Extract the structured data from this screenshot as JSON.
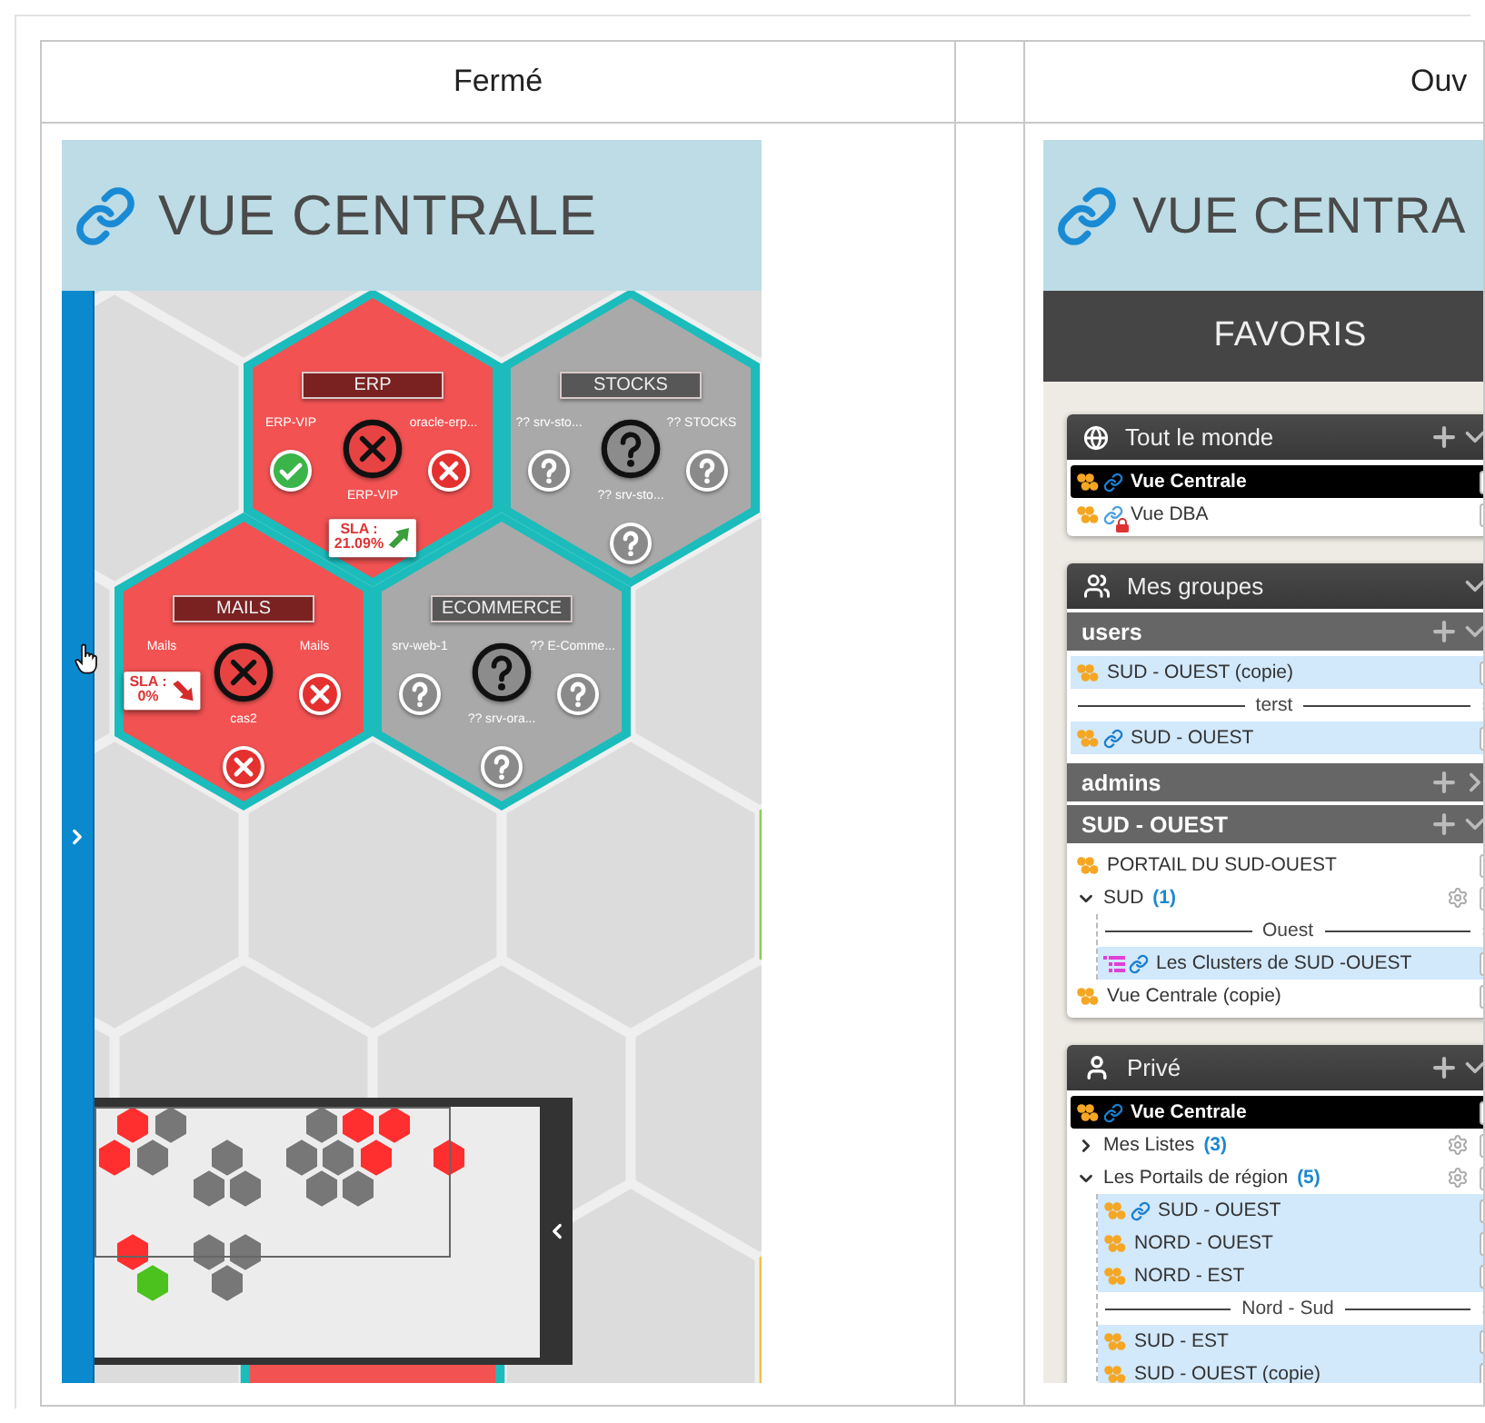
{
  "column_1": {
    "header": "Fermé",
    "screenshot": {
      "title": "VUE CENTRALE",
      "tiles": [
        {
          "title": "ERP",
          "critical": true,
          "nodes": [
            {
              "kind": "ok",
              "label": "ERP-VIP"
            },
            {
              "kind": "critical",
              "label": "oracle-erp..."
            },
            {
              "kind": "sla",
              "label": "ERP-VIP",
              "sla": {
                "label": "SLA :",
                "value": "21.09%",
                "rising": true
              }
            }
          ]
        },
        {
          "title": "STOCKS",
          "critical": false,
          "nodes": [
            {
              "kind": "unknown",
              "label": "?? srv-sto..."
            },
            {
              "kind": "unknown",
              "label": "?? STOCKS"
            },
            {
              "kind": "unknown",
              "label": "?? srv-sto..."
            }
          ]
        },
        {
          "title": "MAILS",
          "critical": true,
          "nodes": [
            {
              "kind": "sla",
              "label": "Mails",
              "sla": {
                "label": "SLA :",
                "value": "0%",
                "rising": false
              }
            },
            {
              "kind": "critical",
              "label": "Mails"
            },
            {
              "kind": "critical",
              "label": "cas2"
            }
          ]
        },
        {
          "title": "ECOMMERCE",
          "critical": false,
          "nodes": [
            {
              "kind": "unknown",
              "label": "srv-web-1"
            },
            {
              "kind": "unknown",
              "label": "?? E-Comme..."
            },
            {
              "kind": "unknown",
              "label": "?? srv-ora..."
            }
          ]
        }
      ]
    }
  },
  "column_3": {
    "header": "Ouv",
    "screenshot": {
      "title": "VUE CENTRA",
      "section_title": "FAVORIS",
      "panels": [
        {
          "kind": "public",
          "title": "Tout le monde",
          "addable": true,
          "expanded": true,
          "items": [
            {
              "kind": "cluster_view",
              "label": "Vue Centrale",
              "selected": true,
              "linked": true,
              "locked": false
            },
            {
              "kind": "cluster_view",
              "label": "Vue DBA",
              "selected": false,
              "highlighted": false,
              "linked": true,
              "locked": true
            }
          ]
        },
        {
          "kind": "groups",
          "title": "Mes groupes",
          "addable": false,
          "expanded": true,
          "groups": [
            {
              "name": "users",
              "addable": true,
              "expanded": true,
              "items": [
                {
                  "kind": "cluster_view",
                  "label": "SUD - OUEST (copie)",
                  "selected": false,
                  "highlighted": true,
                  "linked": false,
                  "locked": false
                },
                {
                  "kind": "separator",
                  "label": "terst"
                },
                {
                  "kind": "cluster_view",
                  "label": "SUD - OUEST",
                  "selected": false,
                  "highlighted": true,
                  "linked": true,
                  "locked": false
                }
              ]
            },
            {
              "name": "admins",
              "addable": true,
              "expanded": false
            },
            {
              "name": "SUD - OUEST",
              "addable": true,
              "expanded": true,
              "items": [
                {
                  "kind": "cluster_view",
                  "label": "PORTAIL DU SUD-OUEST",
                  "selected": false,
                  "highlighted": false,
                  "linked": false,
                  "locked": false
                },
                {
                  "kind": "folder",
                  "label": "SUD",
                  "count": "(1)",
                  "selected": false,
                  "expanded": true,
                  "children": [
                    {
                      "kind": "separator",
                      "label": "Ouest"
                    },
                    {
                      "kind": "list_view",
                      "label": "Les Clusters de SUD -OUEST",
                      "selected": false,
                      "highlighted": true,
                      "linked": true,
                      "locked": false
                    }
                  ]
                },
                {
                  "kind": "cluster_view",
                  "label": "Vue Centrale (copie)",
                  "selected": false,
                  "highlighted": false,
                  "linked": false,
                  "locked": false
                }
              ]
            }
          ]
        },
        {
          "kind": "private",
          "title": "Privé",
          "addable": true,
          "expanded": true,
          "items": [
            {
              "kind": "cluster_view",
              "label": "Vue Centrale",
              "selected": true,
              "linked": true,
              "locked": false
            },
            {
              "kind": "folder",
              "label": "Mes Listes",
              "count": "(3)",
              "selected": false,
              "expanded": false
            },
            {
              "kind": "folder",
              "label": "Les Portails de région",
              "count": "(5)",
              "selected": false,
              "expanded": true,
              "children": [
                {
                  "kind": "cluster_view",
                  "label": "SUD - OUEST",
                  "selected": false,
                  "highlighted": true,
                  "linked": true,
                  "locked": false
                },
                {
                  "kind": "cluster_view",
                  "label": "NORD - OUEST",
                  "selected": false,
                  "highlighted": true,
                  "linked": false,
                  "locked": false
                },
                {
                  "kind": "cluster_view",
                  "label": "NORD - EST",
                  "selected": false,
                  "highlighted": true,
                  "linked": false,
                  "locked": false
                },
                {
                  "kind": "separator",
                  "label": "Nord - Sud"
                },
                {
                  "kind": "cluster_view",
                  "label": "SUD - EST",
                  "selected": false,
                  "highlighted": true,
                  "linked": false,
                  "locked": false
                },
                {
                  "kind": "cluster_view",
                  "label": "SUD - OUEST (copie)",
                  "selected": false,
                  "highlighted": true,
                  "linked": false,
                  "locked": false
                }
              ]
            }
          ]
        }
      ]
    }
  }
}
